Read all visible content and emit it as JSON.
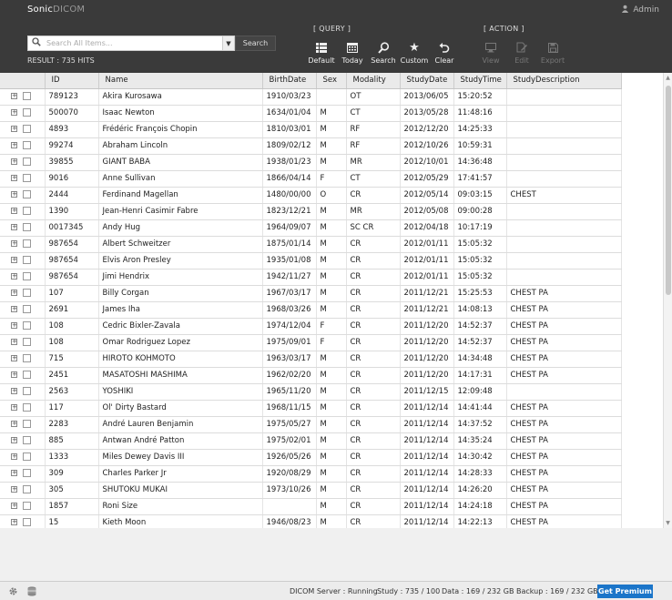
{
  "brand": {
    "part1": "Sonic",
    "part2": "DICOM"
  },
  "user": {
    "name": "Admin"
  },
  "search": {
    "placeholder": "Search All Items...",
    "button_label": "Search"
  },
  "result_text": "RESULT : 735 HITS",
  "query": {
    "label": "[ QUERY ]",
    "buttons": [
      {
        "label": "Default",
        "icon": "list-icon"
      },
      {
        "label": "Today",
        "icon": "calendar-icon"
      },
      {
        "label": "Search",
        "icon": "magnifier-icon"
      },
      {
        "label": "Custom",
        "icon": "star-icon"
      },
      {
        "label": "Clear",
        "icon": "undo-icon"
      }
    ]
  },
  "action": {
    "label": "[ ACTION ]",
    "buttons": [
      {
        "label": "View",
        "icon": "monitor-icon"
      },
      {
        "label": "Edit",
        "icon": "edit-icon"
      },
      {
        "label": "Export",
        "icon": "save-icon"
      }
    ]
  },
  "table": {
    "columns": [
      "ID",
      "Name",
      "BirthDate",
      "Sex",
      "Modality",
      "StudyDate",
      "StudyTime",
      "StudyDescription"
    ],
    "rows": [
      [
        "789123",
        "Akira Kurosawa",
        "1910/03/23",
        "",
        "OT",
        "2013/06/05",
        "15:20:52",
        ""
      ],
      [
        "500070",
        "Isaac Newton",
        "1634/01/04",
        "M",
        "CT",
        "2013/05/28",
        "11:48:16",
        ""
      ],
      [
        "4893",
        "Frédéric François Chopin",
        "1810/03/01",
        "M",
        "RF",
        "2012/12/20",
        "14:25:33",
        ""
      ],
      [
        "99274",
        "Abraham Lincoln",
        "1809/02/12",
        "M",
        "RF",
        "2012/10/26",
        "10:59:31",
        ""
      ],
      [
        "39855",
        "GIANT BABA",
        "1938/01/23",
        "M",
        "MR",
        "2012/10/01",
        "14:36:48",
        ""
      ],
      [
        "9016",
        "Anne Sullivan",
        "1866/04/14",
        "F",
        "CT",
        "2012/05/29",
        "17:41:57",
        ""
      ],
      [
        "2444",
        "Ferdinand Magellan",
        "1480/00/00",
        "O",
        "CR",
        "2012/05/14",
        "09:03:15",
        "CHEST"
      ],
      [
        "1390",
        "Jean-Henri Casimir Fabre",
        "1823/12/21",
        "M",
        "MR",
        "2012/05/08",
        "09:00:28",
        ""
      ],
      [
        "0017345",
        "Andy Hug",
        "1964/09/07",
        "M",
        "SC CR",
        "2012/04/18",
        "10:17:19",
        ""
      ],
      [
        "987654",
        "Albert Schweitzer",
        "1875/01/14",
        "M",
        "CR",
        "2012/01/11",
        "15:05:32",
        ""
      ],
      [
        "987654",
        "Elvis Aron Presley",
        "1935/01/08",
        "M",
        "CR",
        "2012/01/11",
        "15:05:32",
        ""
      ],
      [
        "987654",
        "Jimi Hendrix",
        "1942/11/27",
        "M",
        "CR",
        "2012/01/11",
        "15:05:32",
        ""
      ],
      [
        "107",
        "Billy Corgan",
        "1967/03/17",
        "M",
        "CR",
        "2011/12/21",
        "15:25:53",
        "CHEST PA"
      ],
      [
        "2691",
        "James Iha",
        "1968/03/26",
        "M",
        "CR",
        "2011/12/21",
        "14:08:13",
        "CHEST PA"
      ],
      [
        "108",
        "Cedric Bixler-Zavala",
        "1974/12/04",
        "F",
        "CR",
        "2011/12/20",
        "14:52:37",
        "CHEST PA"
      ],
      [
        "108",
        "Omar Rodriguez Lopez",
        "1975/09/01",
        "F",
        "CR",
        "2011/12/20",
        "14:52:37",
        "CHEST PA"
      ],
      [
        "715",
        "HIROTO KOHMOTO",
        "1963/03/17",
        "M",
        "CR",
        "2011/12/20",
        "14:34:48",
        "CHEST PA"
      ],
      [
        "2451",
        "MASATOSHI MASHIMA",
        "1962/02/20",
        "M",
        "CR",
        "2011/12/20",
        "14:17:31",
        "CHEST PA"
      ],
      [
        "2563",
        "YOSHIKI",
        "1965/11/20",
        "M",
        "CR",
        "2011/12/15",
        "12:09:48",
        ""
      ],
      [
        "117",
        "Ol' Dirty Bastard",
        "1968/11/15",
        "M",
        "CR",
        "2011/12/14",
        "14:41:44",
        "CHEST PA"
      ],
      [
        "2283",
        "André Lauren Benjamin",
        "1975/05/27",
        "M",
        "CR",
        "2011/12/14",
        "14:37:52",
        "CHEST PA"
      ],
      [
        "885",
        "Antwan André Patton",
        "1975/02/01",
        "M",
        "CR",
        "2011/12/14",
        "14:35:24",
        "CHEST PA"
      ],
      [
        "1333",
        "Miles Dewey Davis III",
        "1926/05/26",
        "M",
        "CR",
        "2011/12/14",
        "14:30:42",
        "CHEST PA"
      ],
      [
        "309",
        "Charles Parker Jr",
        "1920/08/29",
        "M",
        "CR",
        "2011/12/14",
        "14:28:33",
        "CHEST PA"
      ],
      [
        "305",
        "SHUTOKU MUKAI",
        "1973/10/26",
        "M",
        "CR",
        "2011/12/14",
        "14:26:20",
        "CHEST PA"
      ],
      [
        "1857",
        "Roni Size",
        "",
        "M",
        "CR",
        "2011/12/14",
        "14:24:18",
        "CHEST PA"
      ],
      [
        "15",
        "Kieth Moon",
        "1946/08/23",
        "M",
        "CR",
        "2011/12/14",
        "14:22:13",
        "CHEST PA"
      ]
    ]
  },
  "footer": {
    "server_status": "DICOM Server : Running",
    "study": "Study : 735 / 100",
    "data": "Data : 169 / 232 GB",
    "backup": "Backup : 169 / 232 GB",
    "premium_label": "Get Premium"
  },
  "colors": {
    "topbar": "#3a3a3a",
    "premium": "#1b75c9"
  }
}
